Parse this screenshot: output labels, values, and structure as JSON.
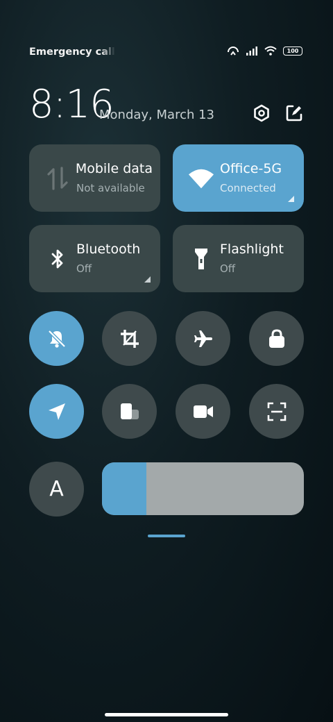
{
  "status_bar": {
    "carrier_text": "Emergency calls only",
    "battery": "100"
  },
  "header": {
    "time": "8:16",
    "date": "Monday, March 13"
  },
  "tiles": {
    "mobile_data": {
      "label": "Mobile data",
      "status": "Not available",
      "active": false
    },
    "wifi": {
      "label": "Office-5G",
      "status": "Connected",
      "active": true
    },
    "bluetooth": {
      "label": "Bluetooth",
      "status": "Off",
      "active": false
    },
    "flashlight": {
      "label": "Flashlight",
      "status": "Off",
      "active": false
    }
  },
  "toggles": [
    {
      "name": "mute-toggle",
      "icon": "bell-off-icon",
      "active": true
    },
    {
      "name": "screenshot-toggle",
      "icon": "crop-icon",
      "active": false
    },
    {
      "name": "airplane-mode-toggle",
      "icon": "airplane-icon",
      "active": false
    },
    {
      "name": "lock-screen-toggle",
      "icon": "lock-icon",
      "active": false
    },
    {
      "name": "location-toggle",
      "icon": "location-arrow-icon",
      "active": true
    },
    {
      "name": "floating-window-toggle",
      "icon": "floating-window-icon",
      "active": false
    },
    {
      "name": "screen-recorder-toggle",
      "icon": "video-camera-icon",
      "active": false
    },
    {
      "name": "scanner-toggle",
      "icon": "scan-icon",
      "active": false
    }
  ],
  "font_button": {
    "label": "A"
  },
  "brightness": {
    "level": 0.22
  },
  "colors": {
    "accent": "#5aa4cf",
    "tile_bg": "#3a4849",
    "round_bg": "#3f4a4c",
    "slider_track": "#a3a9aa"
  }
}
